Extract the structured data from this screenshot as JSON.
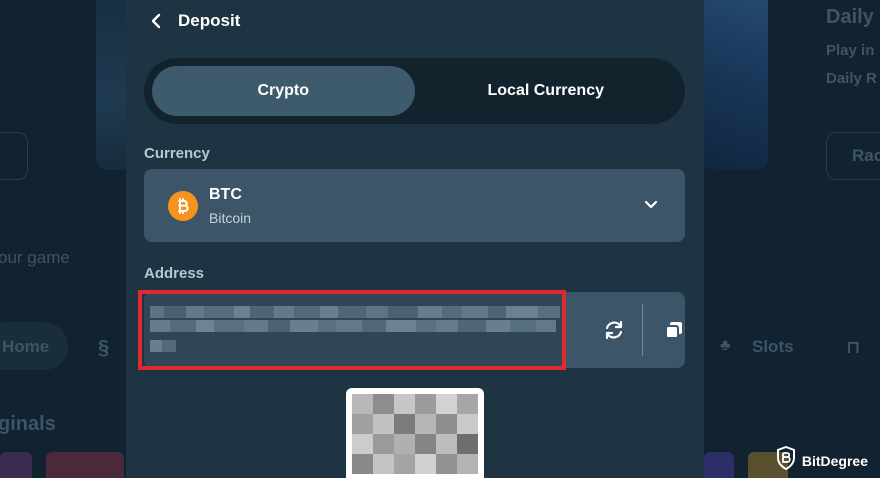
{
  "modal": {
    "title": "Deposit",
    "tabs": [
      {
        "label": "Crypto",
        "active": true
      },
      {
        "label": "Local Currency",
        "active": false
      }
    ],
    "currency_label": "Currency",
    "selected_currency": {
      "code": "BTC",
      "name": "Bitcoin",
      "icon": "bitcoin-icon",
      "color": "#f7931a"
    },
    "address_label": "Address",
    "address_value_obscured": true,
    "highlight_color": "#e02a2f"
  },
  "background": {
    "daily_title": "Daily",
    "daily_sub1": "Play in",
    "daily_sub2": "Daily R",
    "your_game": "our game",
    "home": "Home",
    "slots": "Slots",
    "originals": "ginals",
    "right_button": "Rac"
  },
  "watermark": {
    "text": "BitDegree"
  }
}
